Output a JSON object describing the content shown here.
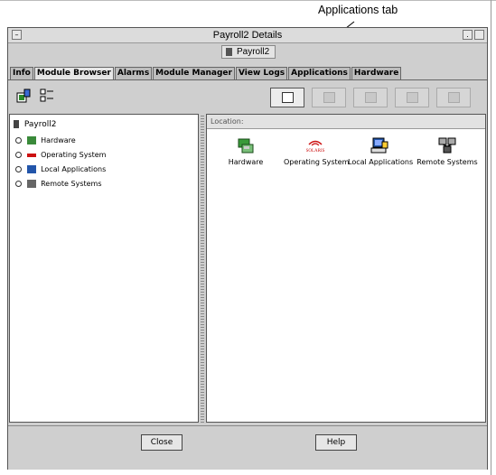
{
  "annotation": {
    "text": "Applications tab"
  },
  "window": {
    "title": "Payroll2  Details",
    "subtitle": "Payroll2"
  },
  "tabs": [
    {
      "label": "Info",
      "active": false
    },
    {
      "label": "Module Browser",
      "active": true
    },
    {
      "label": "Alarms",
      "active": false
    },
    {
      "label": "Module Manager",
      "active": false
    },
    {
      "label": "View Logs",
      "active": false
    },
    {
      "label": "Applications",
      "active": false
    },
    {
      "label": "Hardware",
      "active": false
    }
  ],
  "tree": {
    "root": "Payroll2",
    "items": [
      "Hardware",
      "Operating System",
      "Local Applications",
      "Remote Systems"
    ]
  },
  "location_label": "Location:",
  "icons": [
    {
      "label": "Hardware",
      "icon": "hardware-icon"
    },
    {
      "label": "Operating System",
      "icon": "solaris-icon",
      "logo_text": "SOLARIS"
    },
    {
      "label": "Local Applications",
      "icon": "local-applications-icon"
    },
    {
      "label": "Remote Systems",
      "icon": "remote-systems-icon"
    }
  ],
  "buttons": {
    "close": "Close",
    "help": "Help"
  },
  "colors": {
    "window_bg": "#cfcfcf",
    "active_tab": "#e6e6e6",
    "solaris_red": "#cc1111"
  }
}
